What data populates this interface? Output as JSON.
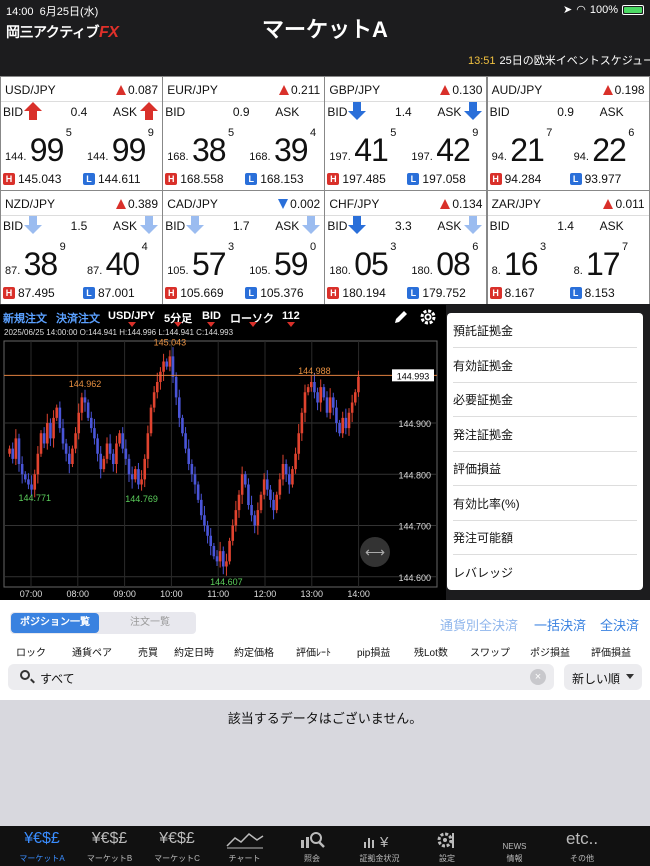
{
  "status": {
    "time": "14:00",
    "date": "6月25日(水)",
    "battery": "100%"
  },
  "header": {
    "logo_text": "岡三アクティブ",
    "logo_fx": "FX",
    "title": "マーケットA",
    "news_time": "13:51",
    "news_text": "25日の欧米イベントスケジュー"
  },
  "rates": [
    {
      "pair": "USD/JPY",
      "change": "0.087",
      "dir": "up",
      "spread": "0.4",
      "bid_pre": "144.",
      "bid_big": "99",
      "bid_sup": "5",
      "ask_pre": "144.",
      "ask_big": "99",
      "ask_sup": "9",
      "bid_arrow": "up-strong",
      "ask_arrow": "up-strong",
      "high": "145.043",
      "low": "144.611"
    },
    {
      "pair": "EUR/JPY",
      "change": "0.211",
      "dir": "up",
      "spread": "0.9",
      "bid_pre": "168.",
      "bid_big": "38",
      "bid_sup": "5",
      "ask_pre": "168.",
      "ask_big": "39",
      "ask_sup": "4",
      "bid_arrow": "none",
      "ask_arrow": "none",
      "high": "168.558",
      "low": "168.153"
    },
    {
      "pair": "GBP/JPY",
      "change": "0.130",
      "dir": "up",
      "spread": "1.4",
      "bid_pre": "197.",
      "bid_big": "41",
      "bid_sup": "5",
      "ask_pre": "197.",
      "ask_big": "42",
      "ask_sup": "9",
      "bid_arrow": "down-strong",
      "ask_arrow": "down-strong",
      "high": "197.485",
      "low": "197.058"
    },
    {
      "pair": "AUD/JPY",
      "change": "0.198",
      "dir": "up",
      "spread": "0.9",
      "bid_pre": "94.",
      "bid_big": "21",
      "bid_sup": "7",
      "ask_pre": "94.",
      "ask_big": "22",
      "ask_sup": "6",
      "bid_arrow": "none",
      "ask_arrow": "none",
      "high": "94.284",
      "low": "93.977"
    },
    {
      "pair": "NZD/JPY",
      "change": "0.389",
      "dir": "up",
      "spread": "1.5",
      "bid_pre": "87.",
      "bid_big": "38",
      "bid_sup": "9",
      "ask_pre": "87.",
      "ask_big": "40",
      "ask_sup": "4",
      "bid_arrow": "down-light",
      "ask_arrow": "down-light",
      "high": "87.495",
      "low": "87.001"
    },
    {
      "pair": "CAD/JPY",
      "change": "0.002",
      "dir": "down",
      "spread": "1.7",
      "bid_pre": "105.",
      "bid_big": "57",
      "bid_sup": "3",
      "ask_pre": "105.",
      "ask_big": "59",
      "ask_sup": "0",
      "bid_arrow": "down-light",
      "ask_arrow": "down-light",
      "high": "105.669",
      "low": "105.376"
    },
    {
      "pair": "CHF/JPY",
      "change": "0.134",
      "dir": "up",
      "spread": "3.3",
      "bid_pre": "180.",
      "bid_big": "05",
      "bid_sup": "3",
      "ask_pre": "180.",
      "ask_big": "08",
      "ask_sup": "6",
      "bid_arrow": "down-strong",
      "ask_arrow": "down-light",
      "high": "180.194",
      "low": "179.752"
    },
    {
      "pair": "ZAR/JPY",
      "change": "0.011",
      "dir": "up",
      "spread": "1.4",
      "bid_pre": "8.",
      "bid_big": "16",
      "bid_sup": "3",
      "ask_pre": "8.",
      "ask_big": "17",
      "ask_sup": "7",
      "bid_arrow": "none",
      "ask_arrow": "none",
      "high": "8.167",
      "low": "8.153"
    }
  ],
  "chart_toolbar": {
    "new_order": "新規注文",
    "settle_order": "決済注文",
    "pair": "USD/JPY",
    "interval": "5分足",
    "side": "BID",
    "style": "ローソク",
    "count": "112"
  },
  "chart_ohlc": "2025/06/25 14:00:00   O:144.941  H:144.996  L:144.941  C:144.993",
  "chart_data": {
    "type": "candlestick",
    "x_ticks": [
      "07:00",
      "08:00",
      "09:00",
      "10:00",
      "11:00",
      "12:00",
      "13:00",
      "14:00"
    ],
    "y_ticks": [
      "144.900",
      "144.800",
      "144.700",
      "144.600"
    ],
    "ylim": [
      144.58,
      145.06
    ],
    "current_price": "144.993",
    "labels": [
      {
        "text": "145.043",
        "value": 145.043,
        "x_index": 51
      },
      {
        "text": "144.962",
        "value": 144.962,
        "x_index": 24
      },
      {
        "text": "144.988",
        "value": 144.988,
        "x_index": 97
      },
      {
        "text": "144.771",
        "value": 144.771,
        "x_index": 8
      },
      {
        "text": "144.769",
        "value": 144.769,
        "x_index": 42
      },
      {
        "text": "144.607",
        "value": 144.607,
        "x_index": 69
      }
    ],
    "close_series": [
      144.85,
      144.83,
      144.87,
      144.82,
      144.8,
      144.79,
      144.78,
      144.77,
      144.8,
      144.84,
      144.88,
      144.86,
      144.9,
      144.87,
      144.91,
      144.93,
      144.89,
      144.86,
      144.84,
      144.82,
      144.85,
      144.88,
      144.92,
      144.95,
      144.94,
      144.91,
      144.89,
      144.87,
      144.84,
      144.81,
      144.83,
      144.86,
      144.84,
      144.82,
      144.86,
      144.88,
      144.85,
      144.83,
      144.8,
      144.79,
      144.81,
      144.78,
      144.79,
      144.83,
      144.88,
      144.93,
      144.96,
      144.98,
      145.0,
      145.02,
      145.01,
      145.03,
      144.99,
      144.95,
      144.91,
      144.88,
      144.85,
      144.82,
      144.8,
      144.78,
      144.75,
      144.72,
      144.7,
      144.68,
      144.66,
      144.64,
      144.63,
      144.65,
      144.62,
      144.63,
      144.67,
      144.7,
      144.73,
      144.76,
      144.8,
      144.78,
      144.74,
      144.72,
      144.7,
      144.73,
      144.76,
      144.79,
      144.77,
      144.75,
      144.73,
      144.76,
      144.79,
      144.82,
      144.8,
      144.78,
      144.81,
      144.84,
      144.88,
      144.92,
      144.96,
      144.97,
      144.98,
      144.96,
      144.94,
      144.97,
      144.95,
      144.92,
      144.95,
      144.93,
      144.9,
      144.88,
      144.91,
      144.89,
      144.92,
      144.94,
      144.96,
      144.99
    ]
  },
  "margin_menu": [
    "預託証拠金",
    "有効証拠金",
    "必要証拠金",
    "発注証拠金",
    "評価損益",
    "有効比率(%)",
    "発注可能額",
    "レバレッジ"
  ],
  "positions": {
    "seg_on": "ポジション一覧",
    "seg_off": "注文一覧",
    "act1": "通貨別全決済",
    "act2": "一括決済",
    "act3": "全決済",
    "columns": [
      "ロック",
      "通貨ペア",
      "売買",
      "約定日時",
      "約定価格",
      "評価ﾚｰﾄ",
      "pip損益",
      "残Lot数",
      "スワップ",
      "ポジ損益",
      "評価損益"
    ],
    "search_text": "すべて",
    "sort_value": "新しい順",
    "empty_message": "該当するデータはございません。"
  },
  "tabs": [
    {
      "icon": "¥€$£",
      "label": "マーケットA",
      "active": true
    },
    {
      "icon": "¥€$£",
      "label": "マーケットB"
    },
    {
      "icon": "¥€$£",
      "label": "マーケットC"
    },
    {
      "icon": "chart-icon",
      "label": "チャート"
    },
    {
      "icon": "search-icon",
      "label": "照会"
    },
    {
      "icon": "margin-icon",
      "label": "証拠金状況"
    },
    {
      "icon": "gear-icon",
      "label": "設定"
    },
    {
      "icon": "NEWS",
      "label": "情報"
    },
    {
      "icon": "etc..",
      "label": "その他"
    }
  ],
  "colors": {
    "up": "#d9302a",
    "down": "#2a6fd9",
    "down_light": "#9bbcf0",
    "accent": "#3a82e0",
    "bull_candle": "#e0432f",
    "bear_candle": "#4a55d8"
  }
}
